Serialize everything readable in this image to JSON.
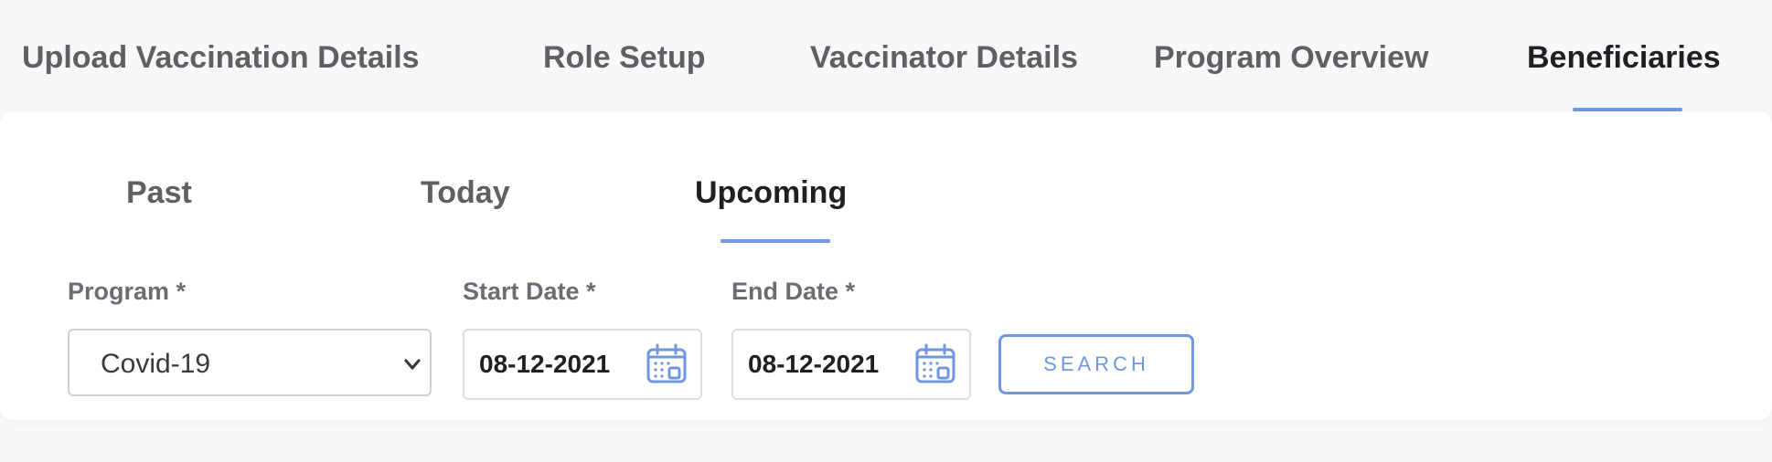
{
  "top_tabs": [
    {
      "label": "Upload Vaccination Details"
    },
    {
      "label": "Role Setup"
    },
    {
      "label": "Vaccinator Details"
    },
    {
      "label": "Program Overview"
    },
    {
      "label": "Beneficiaries",
      "active": true
    }
  ],
  "sub_tabs": [
    {
      "label": "Past"
    },
    {
      "label": "Today"
    },
    {
      "label": "Upcoming",
      "active": true
    }
  ],
  "filters": {
    "program": {
      "label": "Program *",
      "value": "Covid-19"
    },
    "start_date": {
      "label": "Start Date *",
      "value": "08-12-2021"
    },
    "end_date": {
      "label": "End Date *",
      "value": "08-12-2021"
    },
    "search_label": "SEARCH"
  },
  "colors": {
    "accent": "#6f97e0",
    "active_text": "#1f2023",
    "inactive_text": "#5f6063"
  },
  "icons": {
    "program_chevron": "chevron-down-icon",
    "date_picker": "calendar-icon"
  }
}
